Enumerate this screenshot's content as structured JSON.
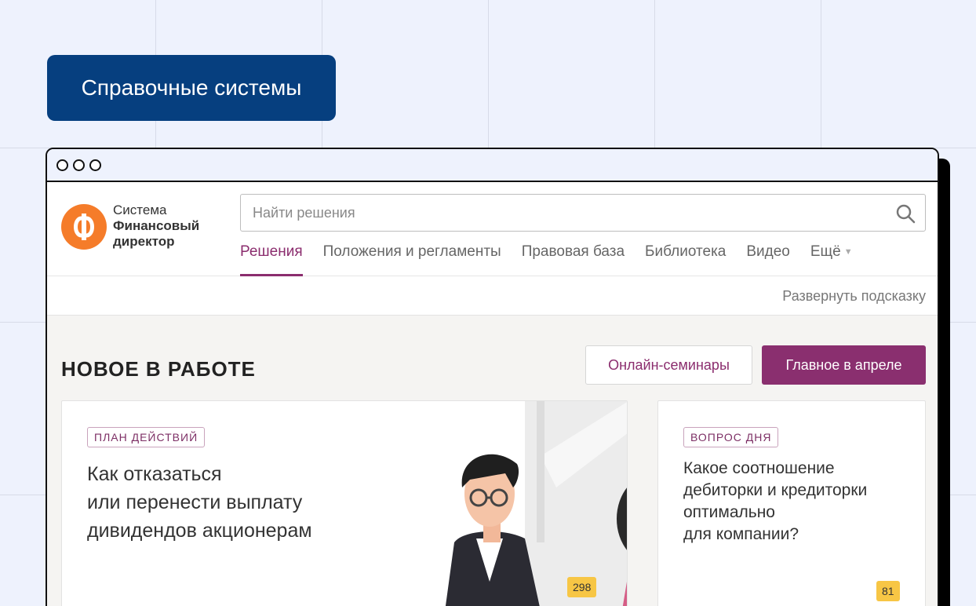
{
  "badge": {
    "label": "Справочные системы"
  },
  "window": {
    "dots": [
      "dot",
      "dot",
      "dot"
    ]
  },
  "logo": {
    "line1": "Система",
    "line2": "Финансовый",
    "line3": "директор",
    "icon": "fd-logo-icon"
  },
  "search": {
    "placeholder": "Найти решения",
    "icon": "search-icon"
  },
  "nav": {
    "items": [
      "Решения",
      "Положения и регламенты",
      "Правовая база",
      "Библиотека",
      "Видео",
      "Ещё"
    ],
    "active": "Решения"
  },
  "hint": {
    "label": "Развернуть подсказку"
  },
  "section": {
    "title": "НОВОЕ В РАБОТЕ",
    "btn_seminars": "Онлайн-семинары",
    "btn_main": "Главное в апреле"
  },
  "cards": [
    {
      "tag": "ПЛАН ДЕЙСТВИЙ",
      "title_lines": [
        "Как отказаться",
        "или перенести выплату",
        "дивидендов акционерам"
      ],
      "count": "298"
    },
    {
      "tag": "ВОПРОС ДНЯ",
      "title_lines": [
        "Какое соотношение",
        "дебиторки и кредиторки",
        "оптимально",
        "для компании?"
      ],
      "count": "81"
    }
  ],
  "colors": {
    "brand": "#063f7f",
    "accent": "#8a2f6f",
    "logo": "#f57c2a",
    "counter": "#f7c645"
  }
}
